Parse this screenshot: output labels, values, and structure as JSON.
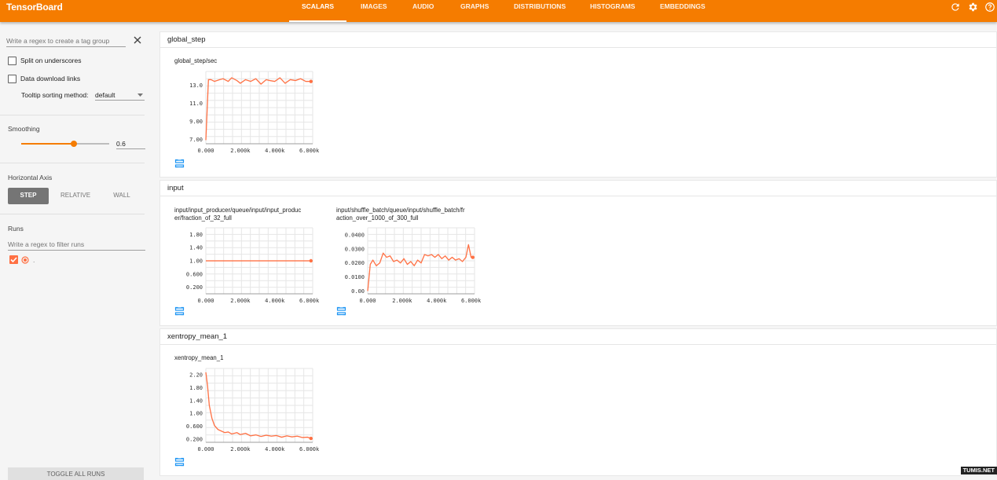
{
  "app": {
    "title": "TensorBoard"
  },
  "nav": {
    "tabs": [
      {
        "label": "SCALARS",
        "active": true
      },
      {
        "label": "IMAGES",
        "active": false
      },
      {
        "label": "AUDIO",
        "active": false
      },
      {
        "label": "GRAPHS",
        "active": false
      },
      {
        "label": "DISTRIBUTIONS",
        "active": false
      },
      {
        "label": "HISTOGRAMS",
        "active": false
      },
      {
        "label": "EMBEDDINGS",
        "active": false
      }
    ],
    "icons": [
      "refresh-icon",
      "settings-icon",
      "help-icon"
    ]
  },
  "sidebar": {
    "tag_regex_placeholder": "Write a regex to create a tag group",
    "split_underscores_label": "Split on underscores",
    "split_underscores_checked": false,
    "data_download_label": "Data download links",
    "data_download_checked": false,
    "tooltip_sort_label": "Tooltip sorting method:",
    "tooltip_sort_value": "default",
    "smoothing_title": "Smoothing",
    "smoothing_value": "0.6",
    "horizontal_axis_title": "Horizontal Axis",
    "axis_options": [
      {
        "label": "STEP",
        "active": true
      },
      {
        "label": "RELATIVE",
        "active": false
      },
      {
        "label": "WALL",
        "active": false
      }
    ],
    "runs_title": "Runs",
    "runs_filter_placeholder": "Write a regex to filter runs",
    "runs": [
      {
        "name": ".",
        "checked": true,
        "color": "#ff7043"
      }
    ],
    "toggle_all_label": "TOGGLE ALL RUNS"
  },
  "colors": {
    "accent": "#f57c00",
    "series": "#ff7043",
    "icon_blue": "#2196f3"
  },
  "sections": [
    {
      "title": "global_step",
      "charts": [
        {
          "title": "global_step/sec",
          "chart_data": {
            "type": "line",
            "x": [
              0,
              150,
              300,
              500,
              800,
              1000,
              1300,
              1500,
              1800,
              2000,
              2300,
              2600,
              2900,
              3200,
              3500,
              3700,
              4000,
              4300,
              4600,
              4900,
              5200,
              5500,
              5800,
              6100
            ],
            "series": [
              {
                "values": [
                  6.9,
                  13.6,
                  13.6,
                  13.4,
                  13.6,
                  13.7,
                  13.4,
                  13.8,
                  13.5,
                  13.2,
                  13.6,
                  13.4,
                  13.7,
                  13.1,
                  13.6,
                  13.5,
                  13.4,
                  13.8,
                  13.2,
                  13.6,
                  13.5,
                  13.7,
                  13.4,
                  13.4
                ]
              }
            ],
            "yticks": [
              "13.0",
              "11.0",
              "9.00",
              "7.00"
            ],
            "xticks": [
              "0.000",
              "2.000k",
              "4.000k",
              "6.000k"
            ],
            "xlim": [
              0,
              6200
            ],
            "ylim": [
              6.5,
              14.5
            ]
          }
        }
      ]
    },
    {
      "title": "input",
      "charts": [
        {
          "title": "input/input_producer/queue/input/input_producer/fraction_of_32_full",
          "chart_data": {
            "type": "line",
            "x": [
              0,
              6100
            ],
            "series": [
              {
                "values": [
                  1.0,
                  1.0
                ]
              }
            ],
            "yticks": [
              "1.80",
              "1.40",
              "1.00",
              "0.600",
              "0.200"
            ],
            "xticks": [
              "0.000",
              "2.000k",
              "4.000k",
              "6.000k"
            ],
            "xlim": [
              0,
              6200
            ],
            "ylim": [
              0.0,
              2.0
            ]
          }
        },
        {
          "title": "input/shuffle_batch/queue/input/shuffle_batch/fraction_over_1000_of_300_full",
          "chart_data": {
            "type": "line",
            "x": [
              0,
              150,
              300,
              500,
              700,
              900,
              1100,
              1300,
              1500,
              1700,
              1900,
              2100,
              2300,
              2500,
              2700,
              2900,
              3100,
              3300,
              3500,
              3700,
              3900,
              4100,
              4300,
              4500,
              4700,
              4900,
              5100,
              5300,
              5500,
              5700,
              5850,
              6000,
              6100
            ],
            "series": [
              {
                "values": [
                  0.0,
                  0.019,
                  0.022,
                  0.018,
                  0.02,
                  0.027,
                  0.024,
                  0.025,
                  0.021,
                  0.022,
                  0.02,
                  0.023,
                  0.019,
                  0.021,
                  0.018,
                  0.022,
                  0.02,
                  0.026,
                  0.025,
                  0.026,
                  0.024,
                  0.026,
                  0.023,
                  0.025,
                  0.022,
                  0.024,
                  0.022,
                  0.023,
                  0.021,
                  0.024,
                  0.033,
                  0.024,
                  0.024
                ]
              }
            ],
            "yticks": [
              "0.0400",
              "0.0300",
              "0.0200",
              "0.0100",
              "0.00"
            ],
            "xticks": [
              "0.000",
              "2.000k",
              "4.000k",
              "6.000k"
            ],
            "xlim": [
              0,
              6200
            ],
            "ylim": [
              -0.002,
              0.045
            ]
          }
        }
      ]
    },
    {
      "title": "xentropy_mean_1",
      "charts": [
        {
          "title": "xentropy_mean_1",
          "chart_data": {
            "type": "line",
            "x": [
              0,
              100,
              200,
              350,
              500,
              700,
              900,
              1100,
              1300,
              1500,
              1800,
              2000,
              2300,
              2600,
              2900,
              3200,
              3500,
              3800,
              4100,
              4400,
              4700,
              5000,
              5300,
              5600,
              5900,
              6100
            ],
            "series": [
              {
                "values": [
                  2.28,
                  1.85,
                  1.25,
                  0.85,
                  0.62,
                  0.5,
                  0.45,
                  0.4,
                  0.42,
                  0.36,
                  0.4,
                  0.34,
                  0.38,
                  0.3,
                  0.33,
                  0.28,
                  0.32,
                  0.29,
                  0.31,
                  0.26,
                  0.3,
                  0.27,
                  0.29,
                  0.25,
                  0.26,
                  0.22
                ]
              }
            ],
            "yticks": [
              "2.20",
              "1.80",
              "1.40",
              "1.00",
              "0.600",
              "0.200"
            ],
            "xticks": [
              "0.000",
              "2.000k",
              "4.000k",
              "6.000k"
            ],
            "xlim": [
              0,
              6200
            ],
            "ylim": [
              0.1,
              2.4
            ]
          }
        }
      ]
    }
  ],
  "watermark": "TUMIS.NET"
}
